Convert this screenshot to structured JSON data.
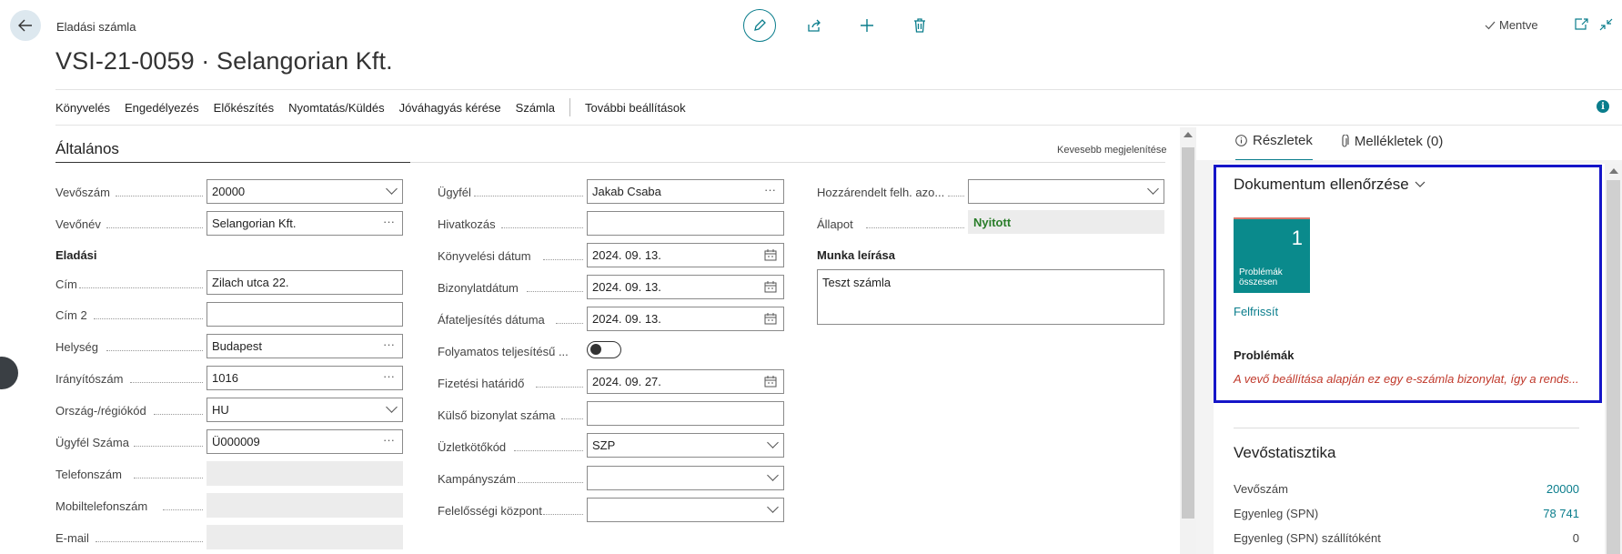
{
  "header": {
    "page_type": "Eladási számla",
    "title": "VSI-21-0059 · Selangorian Kft.",
    "saved_label": "Mentve"
  },
  "actionbar": {
    "items": [
      "Könyvelés",
      "Engedélyezés",
      "Előkészítés",
      "Nyomtatás/Küldés",
      "Jóváhagyás kérése",
      "Számla"
    ],
    "more": "További beállítások"
  },
  "general": {
    "section_title": "Általános",
    "show_less": "Kevesebb megjelenítése",
    "col1": {
      "customer_no_label": "Vevőszám",
      "customer_no": "20000",
      "customer_name_label": "Vevőnév",
      "customer_name": "Selangorian Kft.",
      "sales_head": "Eladási",
      "address_label": "Cím",
      "address": "Zilach utca 22.",
      "address2_label": "Cím 2",
      "address2": "",
      "city_label": "Helység",
      "city": "Budapest",
      "zip_label": "Irányítószám",
      "zip": "1016",
      "country_label": "Ország-/régiókód",
      "country": "HU",
      "cust_num_label": "Ügyfél Száma",
      "cust_num": "Ü000009",
      "phone_label": "Telefonszám",
      "mobile_label": "Mobiltelefonszám",
      "email_label": "E-mail"
    },
    "col2": {
      "contact_label": "Ügyfél",
      "contact": "Jakab Csaba",
      "reference_label": "Hivatkozás",
      "reference": "",
      "posting_date_label": "Könyvelési dátum",
      "posting_date": "2024. 09. 13.",
      "doc_date_label": "Bizonylatdátum",
      "doc_date": "2024. 09. 13.",
      "vat_date_label": "Áfateljesítés dátuma",
      "vat_date": "2024. 09. 13.",
      "continuous_label": "Folyamatos teljesítésű ...",
      "due_date_label": "Fizetési határidő",
      "due_date": "2024. 09. 27.",
      "ext_doc_label": "Külső bizonylat száma",
      "ext_doc": "",
      "salesperson_label": "Üzletkötőkód",
      "salesperson": "SZP",
      "campaign_label": "Kampányszám",
      "campaign": "",
      "resp_center_label": "Felelősségi központ",
      "resp_center": ""
    },
    "col3": {
      "assigned_label": "Hozzárendelt felh. azo...",
      "assigned": "",
      "status_label": "Állapot",
      "status": "Nyitott",
      "work_desc_label": "Munka leírása",
      "work_desc": "Teszt számla"
    }
  },
  "factbox": {
    "tab_details": "Részletek",
    "tab_attachments": "Mellékletek (0)",
    "doc_check_title": "Dokumentum ellenőrzése",
    "tile_count": "1",
    "tile_label_1": "Problémák",
    "tile_label_2": "összesen",
    "refresh": "Felfrissít",
    "problems_head": "Problémák",
    "problem_text": "A vevő beállítása alapján ez egy e-számla bizonylat, így a rends...",
    "stats_title": "Vevőstatisztika",
    "stats": [
      {
        "label": "Vevőszám",
        "value": "20000"
      },
      {
        "label": "Egyenleg (SPN)",
        "value": "78 741"
      },
      {
        "label": "Egyenleg (SPN) szállítóként",
        "value": "0"
      }
    ]
  },
  "colors": {
    "accent": "#0a7d8c",
    "status_green": "#2a7d2a",
    "error_red": "#c0392b",
    "highlight_blue": "#1515c8"
  }
}
